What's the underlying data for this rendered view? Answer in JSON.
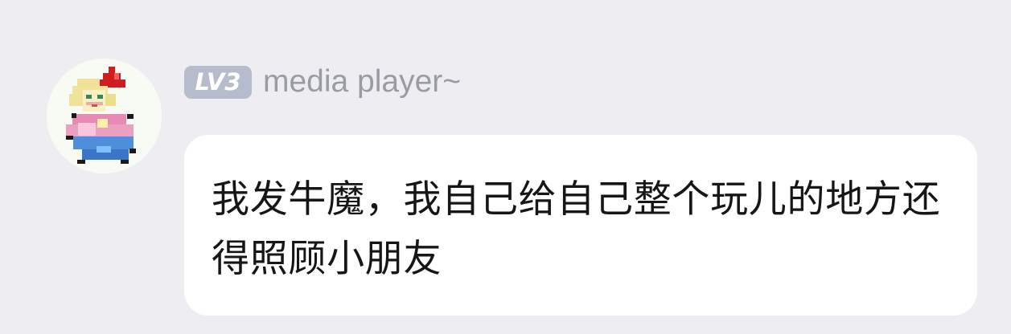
{
  "sender": {
    "level_badge": "LV3",
    "username": "media player~"
  },
  "message": {
    "text": "我发牛魔，我自己给自己整个玩儿的地方还得照顾小朋友"
  },
  "icons": {
    "avatar": "pixel-art-character-avatar"
  },
  "colors": {
    "background": "#eeeef2",
    "bubble": "#ffffff",
    "badge": "#b6bccb",
    "username": "#9a9ca3",
    "message_text": "#161616"
  }
}
